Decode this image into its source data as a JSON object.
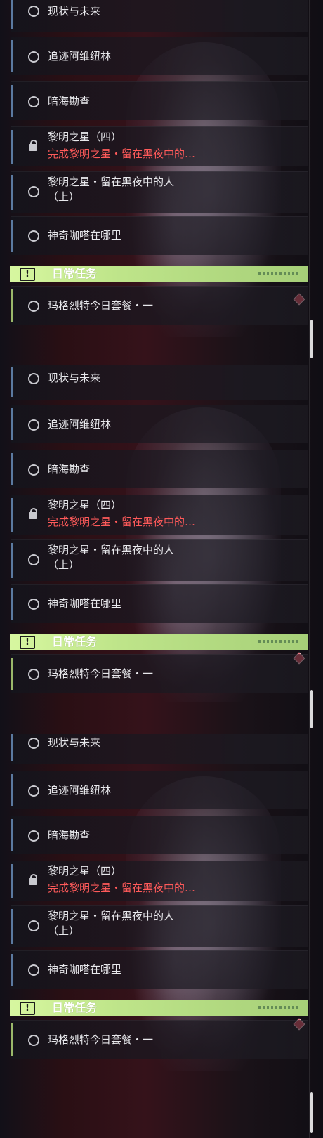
{
  "panels": [
    {
      "tasks": [
        {
          "title": "现状与未来",
          "icon": "circle-icon"
        },
        {
          "title": "追迹阿维纽林",
          "icon": "circle-icon"
        },
        {
          "title": "暗海勘查",
          "icon": "circle-icon"
        },
        {
          "title": "黎明之星（四）",
          "subtitle": "完成黎明之星・留在黑夜中的…",
          "icon": "lock-icon"
        },
        {
          "title": "黎明之星・留在黑夜中的人",
          "title_line2": "（上）",
          "icon": "circle-icon"
        },
        {
          "title": "神奇咖嗒在哪里",
          "icon": "circle-icon"
        }
      ],
      "daily": {
        "badge": "!",
        "title": "日常任务",
        "task": {
          "title": "玛格烈特今日套餐・一",
          "icon": "circle-icon"
        }
      }
    },
    {
      "tasks": [
        {
          "title": "现状与未来",
          "icon": "circle-icon"
        },
        {
          "title": "追迹阿维纽林",
          "icon": "circle-icon"
        },
        {
          "title": "暗海勘查",
          "icon": "circle-icon"
        },
        {
          "title": "黎明之星（四）",
          "subtitle": "完成黎明之星・留在黑夜中的…",
          "icon": "lock-icon"
        },
        {
          "title": "黎明之星・留在黑夜中的人",
          "title_line2": "（上）",
          "icon": "circle-icon"
        },
        {
          "title": "神奇咖嗒在哪里",
          "icon": "circle-icon"
        }
      ],
      "daily": {
        "badge": "!",
        "title": "日常任务",
        "task": {
          "title": "玛格烈特今日套餐・一",
          "icon": "circle-icon"
        }
      }
    },
    {
      "tasks": [
        {
          "title": "现状与未来",
          "icon": "circle-icon"
        },
        {
          "title": "追迹阿维纽林",
          "icon": "circle-icon"
        },
        {
          "title": "暗海勘查",
          "icon": "circle-icon"
        },
        {
          "title": "黎明之星（四）",
          "subtitle": "完成黎明之星・留在黑夜中的…",
          "icon": "lock-icon"
        },
        {
          "title": "黎明之星・留在黑夜中的人",
          "title_line2": "（上）",
          "icon": "circle-icon"
        },
        {
          "title": "神奇咖嗒在哪里",
          "icon": "circle-icon"
        }
      ],
      "daily": {
        "badge": "!",
        "title": "日常任务",
        "task": {
          "title": "玛格烈特今日套餐・一",
          "icon": "circle-icon"
        }
      }
    }
  ],
  "colors": {
    "accent_blue": "#5b7aa0",
    "daily_green": "#c4ea8e",
    "locked_red": "#ff5a5a",
    "badge_red": "#e24a5c"
  }
}
